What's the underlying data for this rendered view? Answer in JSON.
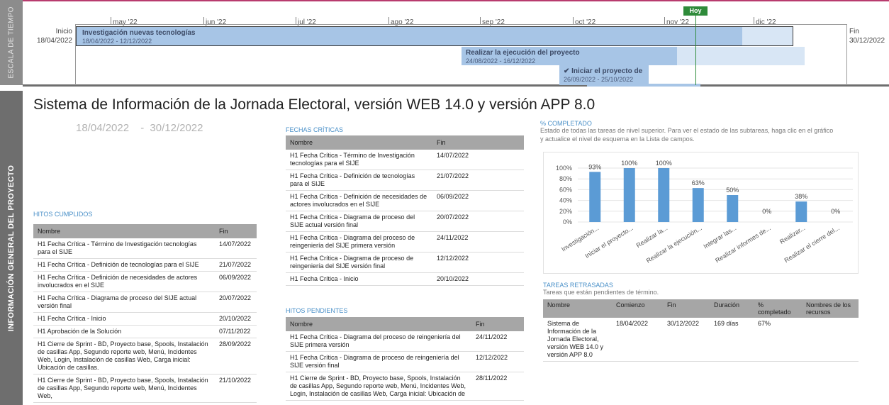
{
  "side": {
    "top": "ESCALA DE TIEMPO",
    "main": "INFORMACIÓN GENERAL DEL PROYECTO"
  },
  "timeline": {
    "months": [
      "may '22",
      "jun '22",
      "jul '22",
      "ago '22",
      "sep '22",
      "oct '22",
      "nov '22",
      "dic '22"
    ],
    "start_label": "Inicio",
    "start_date": "18/04/2022",
    "end_label": "Fin",
    "end_date": "30/12/2022",
    "today": "Hoy",
    "tasks": [
      {
        "title": "Investigación nuevas tecnologías",
        "dates": "18/04/2022 - 12/12/2022"
      },
      {
        "title": "Realizar la ejecución del proyecto",
        "dates": "24/08/2022 - 16/12/2022"
      },
      {
        "title": "✔ Iniciar el proyecto de",
        "dates": "26/09/2022 - 25/10/2022"
      }
    ]
  },
  "title": "Sistema de Información de la Jornada Electoral, versión WEB 14.0 y versión APP 8.0",
  "date_start": "18/04/2022",
  "date_sep": "-",
  "date_end": "30/12/2022",
  "cumplidos": {
    "title": "HITOS CUMPLIDOS",
    "headers": [
      "Nombre",
      "Fin"
    ],
    "rows": [
      [
        "H1 Fecha Crítica - Término de Investigación tecnologías para el SIJE",
        "14/07/2022"
      ],
      [
        "H1 Fecha Crítica - Definición de tecnologías para el SIJE",
        "21/07/2022"
      ],
      [
        "H1 Fecha Crítica - Definición de necesidades de actores involucrados en el SIJE",
        "06/09/2022"
      ],
      [
        "H1 Fecha Crítica - Diagrama de proceso del SIJE actual versión final",
        "20/07/2022"
      ],
      [
        "H1 Fecha Crítica - Inicio",
        "20/10/2022"
      ],
      [
        "H1 Aprobación de la Solución",
        "07/11/2022"
      ],
      [
        "H1 Cierre de Sprint - BD, Proyecto base, Spools, Instalación de casillas App, Segundo reporte web, Menú,  Incidentes Web, Login, Instalación de casillas Web, Carga inicial: Ubicación de casillas.",
        "28/09/2022"
      ],
      [
        "H1 Cierre de Sprint - BD, Proyecto base, Spools, Instalación de casillas App, Segundo reporte web, Menú,  Incidentes Web,",
        "21/10/2022"
      ]
    ]
  },
  "criticas": {
    "title": "FECHAS CRÍTICAS",
    "headers": [
      "Nombre",
      "Fin"
    ],
    "rows": [
      [
        "H1 Fecha Crítica - Término de Investigación tecnologías para el SIJE",
        "14/07/2022"
      ],
      [
        "H1 Fecha Crítica - Definición de tecnologías para el SIJE",
        "21/07/2022"
      ],
      [
        "H1 Fecha Crítica - Definición de necesidades de actores involucrados en el SIJE",
        "06/09/2022"
      ],
      [
        "H1 Fecha Crítica - Diagrama de proceso del SIJE actual versión final",
        "20/07/2022"
      ],
      [
        "H1 Fecha Crítica - Diagrama del proceso de reingeniería del SIJE primera versión",
        "24/11/2022"
      ],
      [
        "H1 Fecha Crítica - Diagrama de proceso de reingeniería del SIJE versión final",
        "12/12/2022"
      ],
      [
        "H1 Fecha Crítica - Inicio",
        "20/10/2022"
      ]
    ]
  },
  "pendientes": {
    "title": "HITOS PENDIENTES",
    "headers": [
      "Nombre",
      "Fin"
    ],
    "rows": [
      [
        "H1 Fecha Crítica - Diagrama del proceso de reingeniería del SIJE primera versión",
        "24/11/2022"
      ],
      [
        "H1 Fecha Crítica - Diagrama de proceso de reingeniería del SIJE versión final",
        "12/12/2022"
      ],
      [
        "H1 Cierre de Sprint - BD, Proyecto base, Spools, Instalación de casillas App, Segundo reporte web, Menú,  Incidentes Web, Login, Instalación de casillas Web, Carga inicial: Ubicación de",
        "28/11/2022"
      ]
    ]
  },
  "completado": {
    "title": "% COMPLETADO",
    "subtitle": "Estado de todas las tareas de nivel superior. Para ver el estado de las subtareas, haga clic en el gráfico y actualice el nivel de esquema en la Lista de campos."
  },
  "chart_data": {
    "type": "bar",
    "categories": [
      "Investigación...",
      "Iniciar el proyecto...",
      "Realizar la...",
      "Realizar la ejecución...",
      "Integrar las...",
      "Realizar informes de...",
      "Realizar...",
      "Realizar el cierre del..."
    ],
    "values": [
      93,
      100,
      100,
      63,
      50,
      0,
      38,
      0
    ],
    "labels": [
      "93%",
      "100%",
      "100%",
      "63%",
      "50%",
      "0%",
      "38%",
      "0%"
    ],
    "yticks": [
      "100%",
      "80%",
      "60%",
      "40%",
      "20%",
      "0%"
    ],
    "ylim": [
      0,
      100
    ],
    "grid": true,
    "color": "#5b9bd5"
  },
  "retrasadas": {
    "title": "TAREAS RETRASADAS",
    "subtitle": "Tareas que están pendientes de término.",
    "headers": [
      "Nombre",
      "Comienzo",
      "Fin",
      "Duración",
      "% completado",
      "Nombres de los recursos"
    ],
    "rows": [
      [
        "Sistema de Información de la Jornada Electoral, versión WEB 14.0 y versión APP 8.0",
        "18/04/2022",
        "30/12/2022",
        "169 días",
        "67%",
        ""
      ]
    ]
  }
}
